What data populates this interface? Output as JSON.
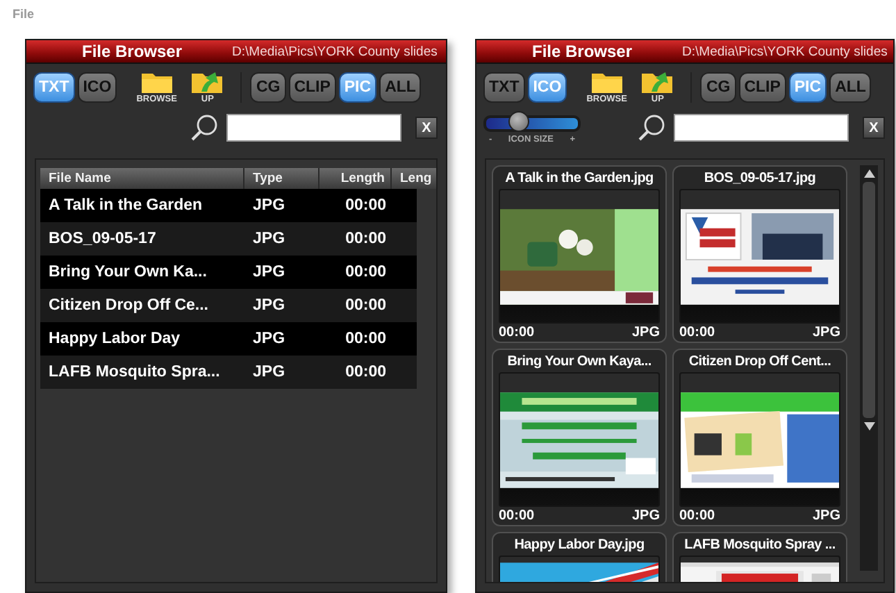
{
  "top_label": "File",
  "panels": [
    {
      "kind": "list",
      "title": "File Browser",
      "path": "D:\\Media\\Pics\\YORK County slides",
      "views": [
        {
          "label": "TXT",
          "selected": true
        },
        {
          "label": "ICO",
          "selected": false
        }
      ],
      "tools": [
        {
          "kind": "browse",
          "label": "BROWSE"
        },
        {
          "kind": "up",
          "label": "UP"
        }
      ],
      "filters": [
        {
          "label": "CG",
          "selected": false
        },
        {
          "label": "CLIP",
          "selected": false
        },
        {
          "label": "PIC",
          "selected": true
        },
        {
          "label": "ALL",
          "selected": false
        }
      ],
      "clear": "X",
      "columns": [
        "File Name",
        "Type",
        "Length",
        "Leng"
      ],
      "rows": [
        {
          "name": "A Talk in the Garden",
          "type": "JPG",
          "length": "00:00"
        },
        {
          "name": "BOS_09-05-17",
          "type": "JPG",
          "length": "00:00"
        },
        {
          "name": "Bring Your Own Ka...",
          "type": "JPG",
          "length": "00:00"
        },
        {
          "name": "Citizen Drop Off Ce...",
          "type": "JPG",
          "length": "00:00"
        },
        {
          "name": "Happy Labor Day",
          "type": "JPG",
          "length": "00:00"
        },
        {
          "name": "LAFB Mosquito Spra...",
          "type": "JPG",
          "length": "00:00"
        }
      ]
    },
    {
      "kind": "icons",
      "title": "File Browser",
      "path": "D:\\Media\\Pics\\YORK County slides",
      "views": [
        {
          "label": "TXT",
          "selected": false
        },
        {
          "label": "ICO",
          "selected": true
        }
      ],
      "tools": [
        {
          "kind": "browse",
          "label": "BROWSE"
        },
        {
          "kind": "up",
          "label": "UP"
        }
      ],
      "filters": [
        {
          "label": "CG",
          "selected": false
        },
        {
          "label": "CLIP",
          "selected": false
        },
        {
          "label": "PIC",
          "selected": true
        },
        {
          "label": "ALL",
          "selected": false
        }
      ],
      "icon_size": {
        "minus": "-",
        "label": "ICON SIZE",
        "plus": "+",
        "level": 0.35
      },
      "clear": "X",
      "tiles": [
        {
          "name": "A Talk in the Garden.jpg",
          "length": "00:00",
          "type": "JPG"
        },
        {
          "name": "BOS_09-05-17.jpg",
          "length": "00:00",
          "type": "JPG"
        },
        {
          "name": "Bring Your Own Kaya...",
          "length": "00:00",
          "type": "JPG"
        },
        {
          "name": "Citizen Drop Off Cent...",
          "length": "00:00",
          "type": "JPG"
        },
        {
          "name": "Happy Labor Day.jpg"
        },
        {
          "name": "LAFB Mosquito Spray ..."
        }
      ]
    }
  ]
}
